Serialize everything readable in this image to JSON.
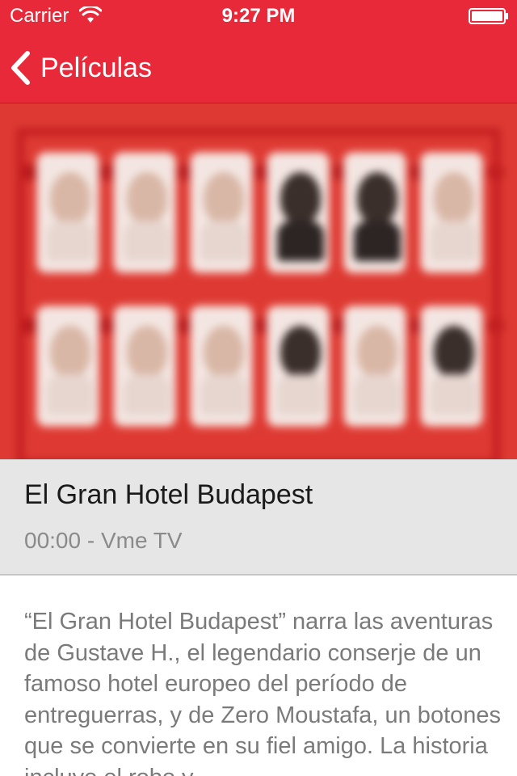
{
  "status_bar": {
    "carrier": "Carrier",
    "time": "9:27 PM",
    "wifi_icon": "wifi-icon",
    "battery_icon": "battery-icon"
  },
  "nav": {
    "back_label": "Películas",
    "back_icon": "chevron-left-icon"
  },
  "colors": {
    "brand_red": "#e8293a",
    "panel_gray": "#e6e6e6",
    "text_gray": "#7a7a7a"
  },
  "movie": {
    "title": "El Gran Hotel Budapest",
    "schedule": "00:00 - Vme TV",
    "synopsis": "“El Gran Hotel Budapest” narra las aventuras de Gustave H., el legendario conserje de un famoso hotel europeo del período de entreguerras, y de Zero Moustafa, un botones que se convierte en su fiel amigo. La historia incluye el robo y"
  }
}
